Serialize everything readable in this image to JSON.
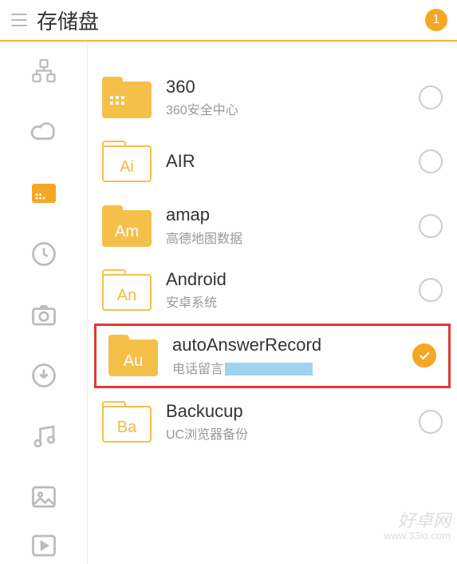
{
  "header": {
    "title": "存储盘",
    "badge": "1"
  },
  "sidebar": {
    "items": [
      {
        "name": "category-icon"
      },
      {
        "name": "cloud-icon"
      },
      {
        "name": "storage-icon",
        "active": true
      },
      {
        "name": "recent-icon"
      },
      {
        "name": "camera-icon"
      },
      {
        "name": "download-icon"
      },
      {
        "name": "music-icon"
      },
      {
        "name": "image-icon"
      },
      {
        "name": "video-icon"
      }
    ]
  },
  "folders": [
    {
      "label": "",
      "title": "360",
      "sub": "360安全中心",
      "checked": false,
      "style": "dots"
    },
    {
      "label": "Ai",
      "title": "AIR",
      "sub": "",
      "checked": false,
      "style": "outline"
    },
    {
      "label": "Am",
      "title": "amap",
      "sub": "高德地图数据",
      "checked": false,
      "style": "solid"
    },
    {
      "label": "An",
      "title": "Android",
      "sub": "安卓系统",
      "checked": false,
      "style": "outline"
    },
    {
      "label": "Au",
      "title": "autoAnswerRecord",
      "sub": "电话留言",
      "checked": true,
      "highlighted": true,
      "style": "solid",
      "redacted": true
    },
    {
      "label": "Ba",
      "title": "Backucup",
      "sub": "UC浏览器备份",
      "checked": false,
      "style": "outline"
    }
  ],
  "watermark": {
    "main": "好卓网",
    "sub": "www.33io.com"
  }
}
